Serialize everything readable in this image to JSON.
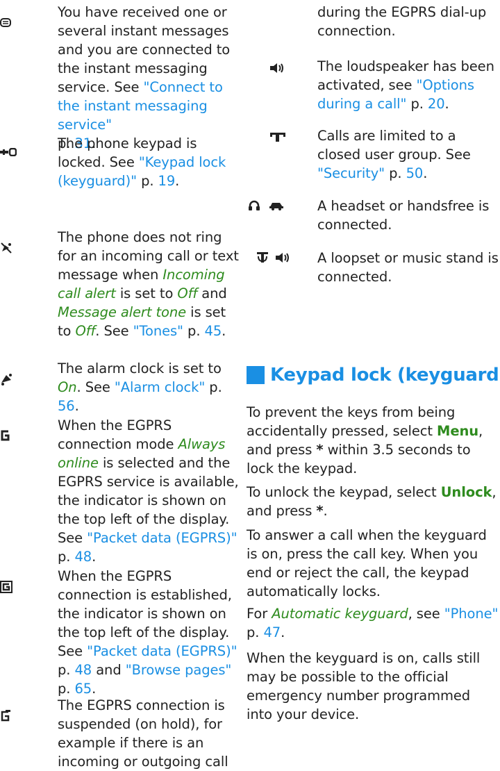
{
  "left_column": {
    "im": {
      "icon": "message-bubble-icon",
      "lines": [
        "You have received one or",
        "several instant messages",
        "and you are connected to",
        "the instant messaging",
        "service. See "
      ],
      "link": "\"Connect to the instant messaging service\"",
      "page": "p. ",
      "page_num": "31",
      "tail": "."
    },
    "keypad": {
      "icon": "key-icon",
      "text": "The phone keypad is locked. See ",
      "link": "\"Keypad lock (keyguard)\"",
      "page": " p. ",
      "page_num": "19",
      "tail": "."
    },
    "silent": {
      "icon": "muted-bell-icon",
      "text1": "The phone does not ring for an incoming call or text message when ",
      "em1": "Incoming call alert",
      "text2": " is set to ",
      "em2": "Off",
      "text3": " and ",
      "em3": "Message alert tone",
      "text4": " is set to ",
      "em4": "Off",
      "text5": ". See ",
      "link": "\"Tones\"",
      "page": " p. ",
      "page_num": "45",
      "tail": "."
    },
    "alarm": {
      "icon": "alarm-bell-icon",
      "text1": "The alarm clock is set to ",
      "em1": "On",
      "text2": ". See ",
      "link": "\"Alarm clock\"",
      "page": " p. ",
      "page_num": "56",
      "tail": "."
    },
    "egprs_online": {
      "icon": "egprs-g-icon",
      "text1": "When the EGPRS connection mode ",
      "em1": "Always online",
      "text2": " is selected and the EGPRS service is available, the indicator is shown on the top left of the display. See ",
      "link": "\"Packet data (EGPRS)\"",
      "page": " p. ",
      "page_num": "48",
      "tail": "."
    },
    "egprs_established": {
      "icon": "egprs-g-boxed-icon",
      "text1": "When the EGPRS connection is established, the indicator is shown on the top left of the display. See ",
      "link1": "\"Packet data (EGPRS)\"",
      "page1": " p. ",
      "page_num1": "48",
      "text2": " and ",
      "link2": "\"Browse pages\"",
      "page2": " p. ",
      "page_num2": "65",
      "tail": "."
    },
    "egprs_suspended": {
      "icon": "egprs-suspended-icon",
      "text": "The EGPRS connection is suspended (on hold), for example if there is an incoming or outgoing call"
    }
  },
  "right_column": {
    "continued": "during the EGPRS dial-up connection.",
    "loudspeaker": {
      "icon": "loudspeaker-icon",
      "text": "The loudspeaker has been activated, see ",
      "link": "\"Options during a call\"",
      "page": " p. ",
      "page_num": "20",
      "tail": "."
    },
    "closed_group": {
      "icon": "closed-user-group-icon",
      "text": "Calls are limited to a closed user group. See ",
      "link": "\"Security\"",
      "page": " p. ",
      "page_num": "50",
      "tail": "."
    },
    "headset": {
      "icons": [
        "headset-icon",
        "car-handsfree-icon"
      ],
      "text": "A headset or handsfree is connected."
    },
    "loopset": {
      "icons": [
        "loopset-icon",
        "music-stand-icon"
      ],
      "text": "A loopset or music stand is connected."
    },
    "section": {
      "title": "Keypad lock (keyguard)",
      "accent": "#1a8fe3"
    },
    "p1": {
      "text1": "To prevent the keys from being accidentally pressed, select ",
      "b1": "Menu",
      "text2": ", and press ",
      "b2": "*",
      "text3": " within 3.5 seconds to lock the keypad."
    },
    "p2": {
      "text1": "To unlock the keypad, select ",
      "b1": "Unlock",
      "text2": ", and press ",
      "b2": "*",
      "text3": "."
    },
    "p3": "To answer a call when the keyguard is on, press the call key. When you end or reject the call, the keypad automatically locks.",
    "p4": {
      "text1": "For ",
      "em1": "Automatic keyguard",
      "text2": ", see ",
      "link": "\"Phone\"",
      "page": " p. ",
      "page_num": "47",
      "tail": "."
    },
    "p5": "When the keyguard is on, calls still may be possible to the official emergency number programmed into your device."
  },
  "colors": {
    "link": "#1a8fe3",
    "emphasis": "#2e8b1e",
    "text": "#222222"
  }
}
